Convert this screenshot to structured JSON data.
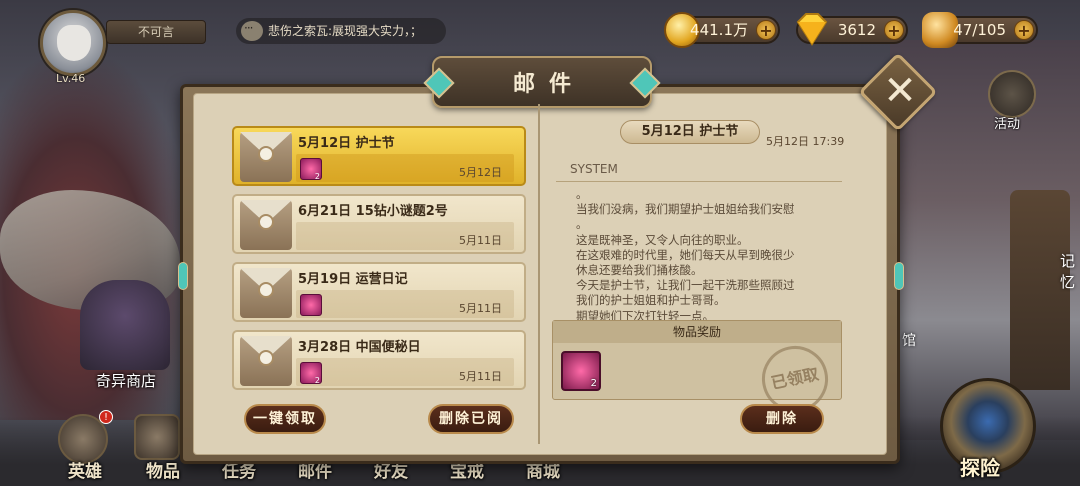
{
  "player": {
    "name_status": "不可言",
    "level": "Lv.46"
  },
  "chat": {
    "message": "悲伤之索瓦:展现强大实力，；"
  },
  "resources": {
    "gold": "441.1万",
    "gems": "3612",
    "stamina": "47/105"
  },
  "side": {
    "activity": "活动",
    "shop": "奇异商店",
    "right_label_1": "记忆",
    "right_label_2": "馆"
  },
  "nav": {
    "items": [
      "英雄",
      "物品",
      "任务",
      "邮件",
      "好友",
      "宝戒",
      "商城"
    ],
    "hero_badge": "!",
    "explore": "探险"
  },
  "mail": {
    "title": "邮件",
    "list": [
      {
        "title": "5月12日 护士节",
        "date": "5月12日",
        "has_gift": true,
        "gift_count": "2",
        "active": true
      },
      {
        "title": "6月21日 15钻小谜题2号",
        "date": "5月11日",
        "has_gift": false,
        "gift_count": "",
        "active": false
      },
      {
        "title": "5月19日 运营日记",
        "date": "5月11日",
        "has_gift": true,
        "gift_count": "",
        "active": false
      },
      {
        "title": "3月28日 中国便秘日",
        "date": "5月11日",
        "has_gift": true,
        "gift_count": "2",
        "active": false
      }
    ],
    "claim_all_label": "一键领取",
    "delete_read_label": "删除已阅",
    "detail": {
      "title": "5月12日 护士节",
      "time": "5月12日 17:39",
      "sender": "SYSTEM",
      "body": [
        "。",
        "当我们没病，我们期望护士姐姐给我们安慰",
        "。",
        "这是既神圣，又令人向往的职业。",
        "在这艰难的时代里，她们每天从早到晚很少",
        "休息还要给我们捅核酸。",
        "今天是护士节，让我们一起干洗那些照顾过",
        "我们的护士姐姐和护士哥哥。",
        "期望她们下次打针轻一点。"
      ],
      "reward_header": "物品奖励",
      "reward_count": "2",
      "claimed_stamp": "已领取",
      "delete_label": "删除"
    }
  }
}
